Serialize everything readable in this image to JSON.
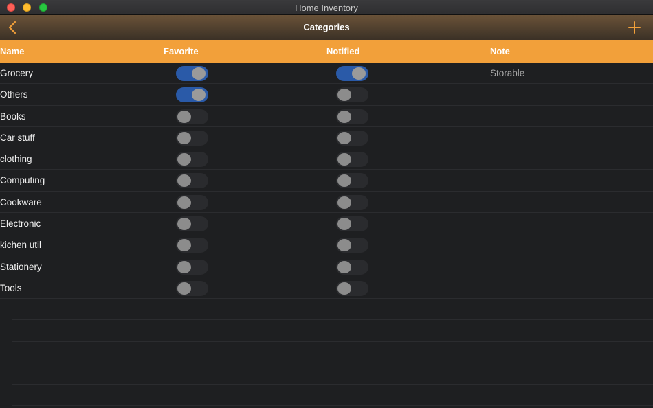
{
  "window": {
    "title": "Home Inventory"
  },
  "navbar": {
    "title": "Categories"
  },
  "columns": {
    "name": "Name",
    "favorite": "Favorite",
    "notified": "Notified",
    "note": "Note"
  },
  "colors": {
    "accent": "#f2a03a",
    "toggle_on": "#2a5aa8",
    "background": "#1e1f21"
  },
  "rows": [
    {
      "name": "Grocery",
      "favorite": true,
      "notified": true,
      "note": "Storable"
    },
    {
      "name": "Others",
      "favorite": true,
      "notified": false,
      "note": ""
    },
    {
      "name": "Books",
      "favorite": false,
      "notified": false,
      "note": ""
    },
    {
      "name": "Car stuff",
      "favorite": false,
      "notified": false,
      "note": ""
    },
    {
      "name": "clothing",
      "favorite": false,
      "notified": false,
      "note": ""
    },
    {
      "name": "Computing",
      "favorite": false,
      "notified": false,
      "note": ""
    },
    {
      "name": "Cookware",
      "favorite": false,
      "notified": false,
      "note": ""
    },
    {
      "name": "Electronic",
      "favorite": false,
      "notified": false,
      "note": ""
    },
    {
      "name": "kichen util",
      "favorite": false,
      "notified": false,
      "note": ""
    },
    {
      "name": "Stationery",
      "favorite": false,
      "notified": false,
      "note": ""
    },
    {
      "name": "Tools",
      "favorite": false,
      "notified": false,
      "note": ""
    }
  ],
  "icons": {
    "back": "chevron-left-icon",
    "add": "plus-icon"
  }
}
